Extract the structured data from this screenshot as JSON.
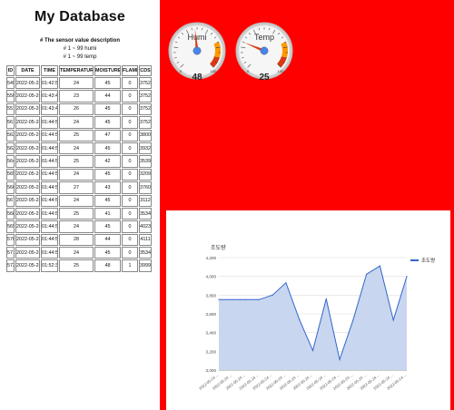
{
  "page": {
    "title": "My Database",
    "description": "# The sensor value description",
    "legend_lines": [
      "# 1 ~ 99 humi",
      "# 1 ~ 99 temp"
    ]
  },
  "table": {
    "headers": [
      "ID",
      "DATE",
      "TIME",
      "TEMPERATURE",
      "MOISTURE",
      "FLAME",
      "CDS"
    ],
    "rows": [
      [
        "549",
        "2022-05-24",
        "01:42:59",
        "24",
        "45",
        "0",
        "3752"
      ],
      [
        "550",
        "2022-05-24",
        "01:43:44",
        "23",
        "44",
        "0",
        "3752"
      ],
      [
        "551",
        "2022-05-24",
        "01:43:45",
        "26",
        "45",
        "0",
        "3752"
      ],
      [
        "561",
        "2022-05-24",
        "01:44:55",
        "24",
        "45",
        "0",
        "3752"
      ],
      [
        "562",
        "2022-05-24",
        "01:44:55",
        "25",
        "47",
        "0",
        "3800"
      ],
      [
        "563",
        "2022-05-24",
        "01:44:55",
        "24",
        "45",
        "0",
        "3932"
      ],
      [
        "564",
        "2022-05-24",
        "01:44:55",
        "25",
        "42",
        "0",
        "3539"
      ],
      [
        "565",
        "2022-05-24",
        "01:44:55",
        "24",
        "45",
        "0",
        "3209"
      ],
      [
        "566",
        "2022-05-24",
        "01:44:55",
        "27",
        "43",
        "0",
        "3760"
      ],
      [
        "567",
        "2022-05-24",
        "01:44:55",
        "24",
        "45",
        "0",
        "3112"
      ],
      [
        "568",
        "2022-05-24",
        "01:44:55",
        "25",
        "41",
        "0",
        "3534"
      ],
      [
        "569",
        "2022-05-24",
        "01:44:55",
        "24",
        "45",
        "0",
        "4023"
      ],
      [
        "570",
        "2022-05-24",
        "01:44:55",
        "28",
        "44",
        "0",
        "4111"
      ],
      [
        "571",
        "2022-05-24",
        "01:44:55",
        "24",
        "45",
        "0",
        "3534"
      ],
      [
        "572",
        "2022-05-24",
        "01:52:39",
        "25",
        "48",
        "1",
        "3999"
      ]
    ]
  },
  "gauges": [
    {
      "label": "Humi",
      "value": 48,
      "value_text": "48",
      "min": 0,
      "max": 100,
      "max_text": "100",
      "min_text": "0"
    },
    {
      "label": "Temp",
      "value": 25,
      "value_text": "25",
      "min": 0,
      "max": 100,
      "max_text": "100",
      "min_text": "0"
    }
  ],
  "colors": {
    "panel_background": "#ff0000",
    "series": "#3366cc",
    "area_fill": "#c6d4ee",
    "needle": "#dc3912",
    "gauge_yellow": "#ff9900",
    "gauge_red": "#dc3912"
  },
  "chart_data": {
    "type": "area",
    "title": "조도량",
    "series": [
      {
        "name": "조도량",
        "values": [
          3752,
          3752,
          3752,
          3752,
          3800,
          3932,
          3539,
          3209,
          3760,
          3112,
          3534,
          4023,
          4111,
          3534,
          3999
        ]
      }
    ],
    "x": [
      "2022-05-24 ...",
      "2022-05-24 ...",
      "2022-05-24 ...",
      "2022-05-24 ...",
      "2022-05-24 ...",
      "2022-05-24 ...",
      "2022-05-24 ...",
      "2022-05-24 ...",
      "2022-05-24 ...",
      "2022-05-24 ...",
      "2022-05-24 ...",
      "2022-05-24 ...",
      "2022-05-24 ...",
      "2022-05-24 ...",
      "2022-05-24 ..."
    ],
    "ylim": [
      3000,
      4200
    ],
    "yticks": [
      3000,
      3200,
      3400,
      3600,
      3800,
      4000,
      4200
    ],
    "ytick_labels": [
      "3,000",
      "3,200",
      "3,400",
      "3,600",
      "3,800",
      "4,000",
      "4,200"
    ],
    "grid": true,
    "legend": "right"
  }
}
